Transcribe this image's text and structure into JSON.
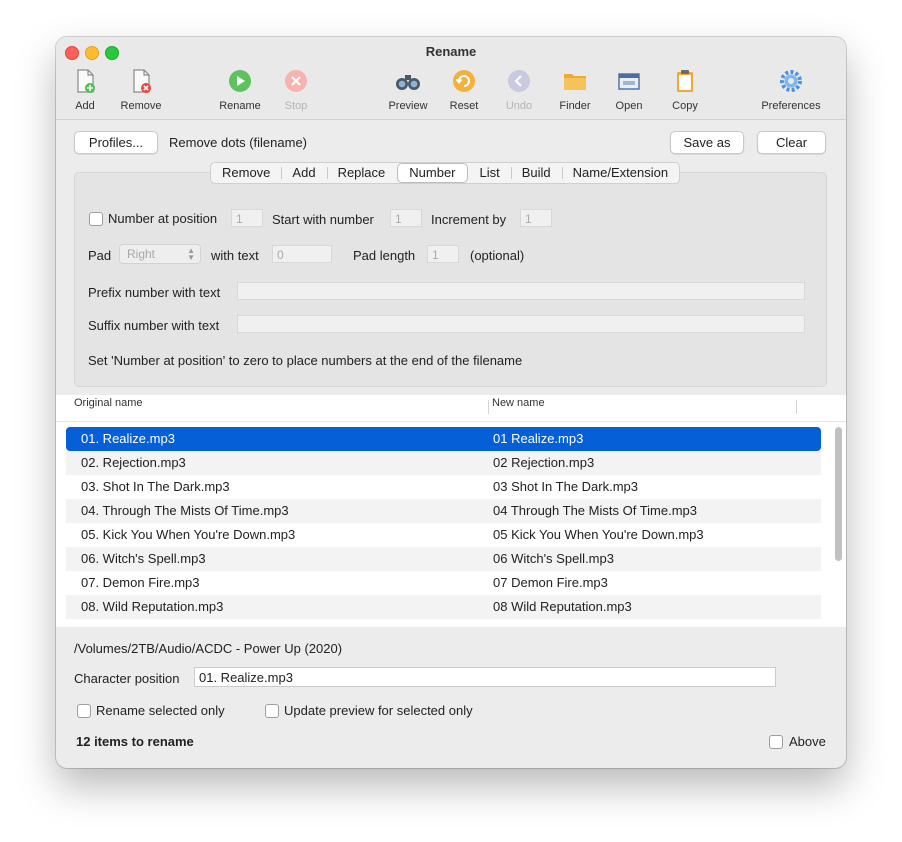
{
  "window": {
    "title": "Rename"
  },
  "toolbar": {
    "items": [
      {
        "label": "Add",
        "icon": "add-file-icon",
        "enabled": true
      },
      {
        "label": "Remove",
        "icon": "remove-file-icon",
        "enabled": true
      },
      {
        "label": "Rename",
        "icon": "play-icon",
        "enabled": true
      },
      {
        "label": "Stop",
        "icon": "stop-icon",
        "enabled": false
      },
      {
        "label": "Preview",
        "icon": "binoculars-icon",
        "enabled": true
      },
      {
        "label": "Reset",
        "icon": "reset-icon",
        "enabled": true
      },
      {
        "label": "Undo",
        "icon": "undo-icon",
        "enabled": false
      },
      {
        "label": "Finder",
        "icon": "folder-icon",
        "enabled": true
      },
      {
        "label": "Open",
        "icon": "open-window-icon",
        "enabled": true
      },
      {
        "label": "Copy",
        "icon": "clipboard-icon",
        "enabled": true
      },
      {
        "label": "Preferences",
        "icon": "gear-icon",
        "enabled": true
      }
    ]
  },
  "profiles": {
    "button": "Profiles...",
    "current": "Remove dots (filename)",
    "save_as": "Save as",
    "clear": "Clear"
  },
  "tabs": {
    "items": [
      "Remove",
      "Add",
      "Replace",
      "Number",
      "List",
      "Build",
      "Name/Extension"
    ],
    "active": "Number"
  },
  "number": {
    "number_at_position_label": "Number at position",
    "number_at_position_value": "1",
    "start_label": "Start with number",
    "start_value": "1",
    "increment_label": "Increment by",
    "increment_value": "1",
    "pad_label": "Pad",
    "pad_value": "Right",
    "with_text_label": "with text",
    "with_text_value": "0",
    "pad_length_label": "Pad length",
    "pad_length_value": "1",
    "optional_label": "(optional)",
    "prefix_label": "Prefix number with text",
    "suffix_label": "Suffix number with text",
    "hint": "Set 'Number at position' to zero to place numbers at the end of the filename"
  },
  "files": {
    "col_original": "Original name",
    "col_new": "New name",
    "rows": [
      {
        "original": "01. Realize.mp3",
        "new": "01  Realize.mp3"
      },
      {
        "original": "02. Rejection.mp3",
        "new": "02  Rejection.mp3"
      },
      {
        "original": "03. Shot In The Dark.mp3",
        "new": "03  Shot In The Dark.mp3"
      },
      {
        "original": "04. Through The Mists Of Time.mp3",
        "new": "04  Through The Mists Of Time.mp3"
      },
      {
        "original": "05. Kick You When You're Down.mp3",
        "new": "05  Kick You When You're Down.mp3"
      },
      {
        "original": "06. Witch's Spell.mp3",
        "new": "06  Witch's Spell.mp3"
      },
      {
        "original": "07. Demon Fire.mp3",
        "new": "07  Demon Fire.mp3"
      },
      {
        "original": "08. Wild Reputation.mp3",
        "new": "08  Wild Reputation.mp3"
      }
    ]
  },
  "footer": {
    "path": "/Volumes/2TB/Audio/ACDC - Power Up (2020)",
    "char_position_label": "Character position",
    "char_position_value": "01. Realize.mp3",
    "rename_selected_only": "Rename selected only",
    "update_preview_selected": "Update preview for selected only",
    "count": "12 items to rename",
    "above": "Above"
  },
  "colors": {
    "selection": "#0560d8",
    "close": "#fe5f57",
    "minimize": "#febc2e",
    "maximize": "#28c840"
  }
}
